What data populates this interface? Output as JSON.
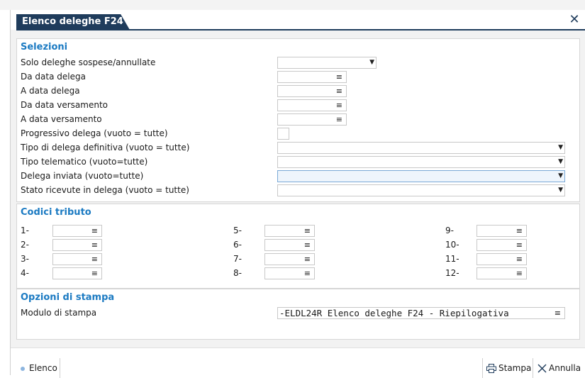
{
  "window": {
    "title": "Elenco deleghe F24",
    "close_glyph": "✕"
  },
  "selezioni": {
    "title": "Selezioni",
    "fields": [
      {
        "label": "Solo deleghe sospese/annullate",
        "value": "",
        "type": "dropdown"
      },
      {
        "label": "Da data delega",
        "value": "",
        "type": "date"
      },
      {
        "label": "A data delega",
        "value": "",
        "type": "date"
      },
      {
        "label": "Da data versamento",
        "value": "",
        "type": "date"
      },
      {
        "label": "A data versamento",
        "value": "",
        "type": "date"
      },
      {
        "label": "Progressivo delega (vuoto = tutte)",
        "value": "",
        "type": "text"
      },
      {
        "label": "Tipo di delega definitiva (vuoto = tutte)",
        "value": "",
        "type": "dropdown"
      },
      {
        "label": "Tipo telematico (vuoto=tutte)",
        "value": "",
        "type": "dropdown"
      },
      {
        "label": "Delega inviata (vuoto=tutte)",
        "value": "",
        "type": "dropdown",
        "focused": true
      },
      {
        "label": "Stato ricevute in delega (vuoto = tutte)",
        "value": "",
        "type": "dropdown"
      }
    ]
  },
  "codici": {
    "title": "Codici tributo",
    "items": [
      {
        "label": "1-",
        "value": ""
      },
      {
        "label": "2-",
        "value": ""
      },
      {
        "label": "3-",
        "value": ""
      },
      {
        "label": "4-",
        "value": ""
      },
      {
        "label": "5-",
        "value": ""
      },
      {
        "label": "6-",
        "value": ""
      },
      {
        "label": "7-",
        "value": ""
      },
      {
        "label": "8-",
        "value": ""
      },
      {
        "label": "9-",
        "value": ""
      },
      {
        "label": "10-",
        "value": ""
      },
      {
        "label": "11-",
        "value": ""
      },
      {
        "label": "12-",
        "value": ""
      }
    ]
  },
  "opzioni": {
    "title": "Opzioni di stampa",
    "modulo_label": "Modulo di stampa",
    "modulo_value": "-ELDL24R Elenco deleghe F24 - Riepilogativa"
  },
  "footer": {
    "elenco": "Elenco",
    "stampa": "Stampa",
    "annulla": "Annulla"
  },
  "glyphs": {
    "menu": "≡",
    "arrow": "▼"
  },
  "colors": {
    "header": "#1f3c5c",
    "section_title": "#1b7ac2",
    "focus_bg": "#eef5fc"
  }
}
